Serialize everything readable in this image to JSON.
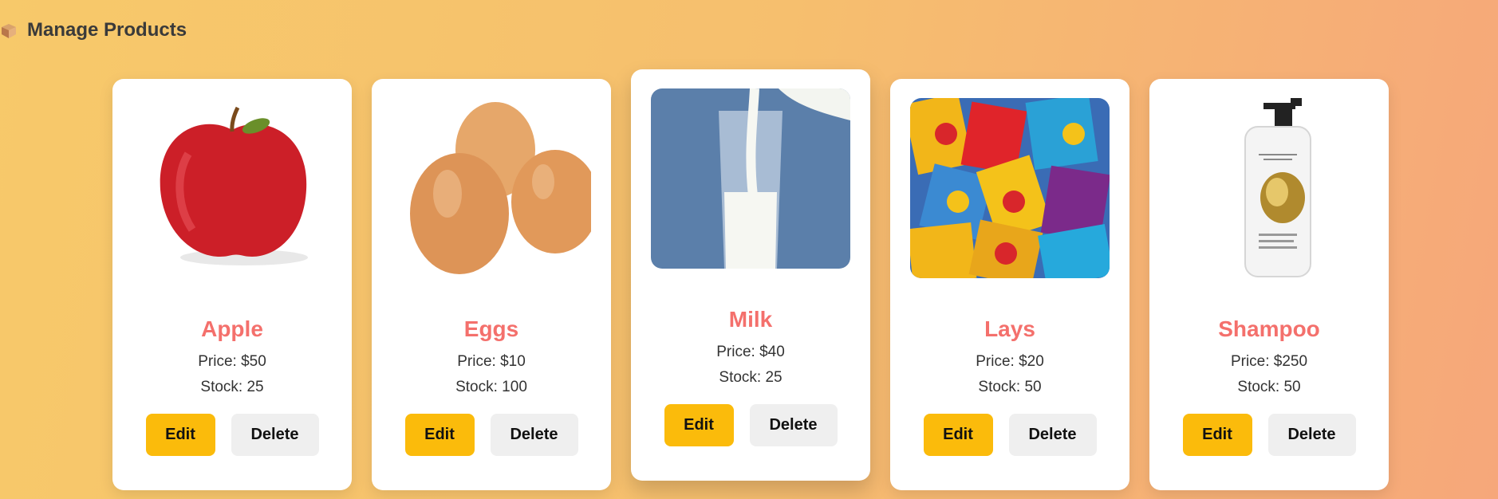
{
  "header": {
    "title": "Manage Products",
    "icon": "box-icon"
  },
  "products": [
    {
      "name": "Apple",
      "price": "Price: $50",
      "stock": "Stock: 25",
      "edit": "Edit",
      "delete": "Delete"
    },
    {
      "name": "Eggs",
      "price": "Price: $10",
      "stock": "Stock: 100",
      "edit": "Edit",
      "delete": "Delete"
    },
    {
      "name": "Milk",
      "price": "Price: $40",
      "stock": "Stock: 25",
      "edit": "Edit",
      "delete": "Delete"
    },
    {
      "name": "Lays",
      "price": "Price: $20",
      "stock": "Stock: 50",
      "edit": "Edit",
      "delete": "Delete"
    },
    {
      "name": "Shampoo",
      "price": "Price: $250",
      "stock": "Stock: 50",
      "edit": "Edit",
      "delete": "Delete"
    }
  ],
  "colors": {
    "product_name": "#f4706c",
    "edit_button": "#fbbb0b",
    "delete_button": "#efefef",
    "background_start": "#f7c96a",
    "background_end": "#f6a77a"
  }
}
